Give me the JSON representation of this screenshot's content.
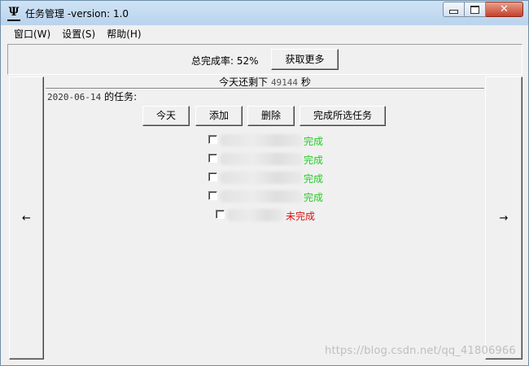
{
  "window": {
    "title": "任务管理 -version: 1.0",
    "app_icon_glyph": "𝄔",
    "app_icon_name": "app-logo-icon",
    "close_glyph": "✕"
  },
  "menu": {
    "items": [
      {
        "label": "窗口(W)"
      },
      {
        "label": "设置(S)"
      },
      {
        "label": "帮助(H)"
      }
    ]
  },
  "top": {
    "rate_label": "总完成率: 52%",
    "more_button": "获取更多"
  },
  "nav": {
    "left_arrow": "←",
    "right_arrow": "→"
  },
  "countdown": {
    "prefix": "今天还剩下",
    "seconds": "49144",
    "suffix": "秒"
  },
  "tasks_header": {
    "date": "2020-06-14",
    "label": "的任务:"
  },
  "buttons": {
    "today": "今天",
    "add": "添加",
    "delete": "删除",
    "complete_selected": "完成所选任务"
  },
  "tasks": [
    {
      "status": "完成",
      "status_color": "#22cc22"
    },
    {
      "status": "完成",
      "status_color": "#22cc22"
    },
    {
      "status": "完成",
      "status_color": "#22cc22"
    },
    {
      "status": "完成",
      "status_color": "#22cc22"
    },
    {
      "status": "未完成",
      "status_color": "#dd1111"
    }
  ],
  "watermark": "https://blog.csdn.net/qq_41806966"
}
